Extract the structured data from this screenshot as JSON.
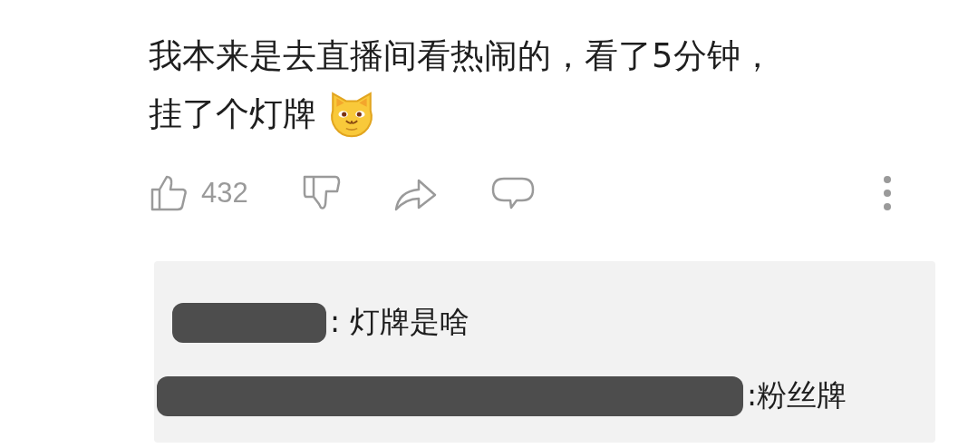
{
  "comment": {
    "lines": [
      "我本来是去直播间看热闹的，看了5分钟，",
      "挂了个灯牌"
    ],
    "like_count": "432"
  },
  "replies": [
    {
      "text": ": 灯牌是啥",
      "kind": "short"
    },
    {
      "text": ":粉丝牌",
      "kind": "long"
    }
  ]
}
